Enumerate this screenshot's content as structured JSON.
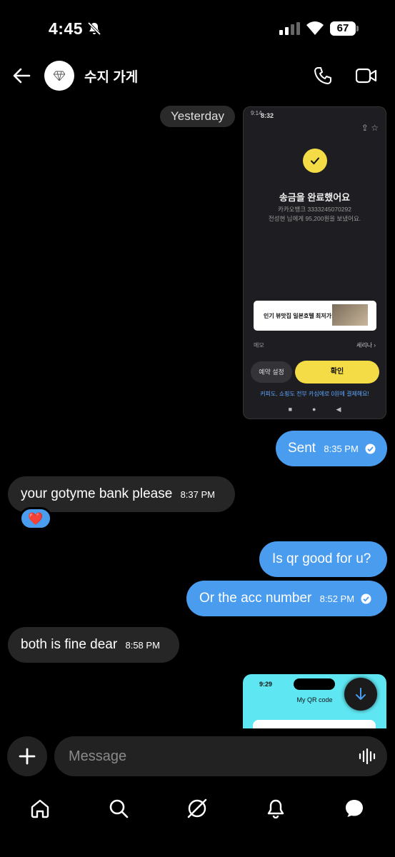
{
  "status_bar": {
    "time": "4:45",
    "battery": "67"
  },
  "header": {
    "title": "수지 가게"
  },
  "chat": {
    "date_pill": "Yesterday",
    "screenshot1": {
      "status_time": "9:14",
      "overlay_time": "8:32",
      "title": "송금을 완료했어요",
      "account_line": "카카오뱅크 3333245070292",
      "sent_line": "전성현 님에게 95,200원을 보냈어요.",
      "ad_text": "인기 뷰맛집 일본호텔 최저가!",
      "memo_label": "메모",
      "memo_value": "세리나 ›",
      "schedule_button": "예약 설정",
      "confirm_button": "확인",
      "link_text": "커피도, 쇼핑도 전부 카심에로 0원에 결제해요!"
    },
    "messages": [
      {
        "text": "Sent",
        "time": "8:35 PM",
        "direction": "out"
      },
      {
        "text": "your gotyme bank please",
        "time": "8:37 PM",
        "direction": "in",
        "reaction": "❤️"
      },
      {
        "text": "Is qr good for u?",
        "time": "",
        "direction": "out"
      },
      {
        "text": "Or the acc number",
        "time": "8:52 PM",
        "direction": "out"
      },
      {
        "text": "both is fine dear",
        "time": "8:58 PM",
        "direction": "in"
      }
    ],
    "screenshot2": {
      "time": "9:29",
      "title": "My QR code"
    }
  },
  "composer": {
    "placeholder": "Message"
  },
  "colors": {
    "outgoing": "#4a9cef",
    "incoming": "#262626",
    "background": "#000000",
    "accent_yellow": "#f4dc46"
  },
  "icons": [
    "back-arrow-icon",
    "call-icon",
    "video-icon",
    "plus-icon",
    "voice-wave-icon",
    "home-icon",
    "search-icon",
    "explore-icon",
    "bell-icon",
    "chat-icon",
    "scroll-down-icon"
  ]
}
